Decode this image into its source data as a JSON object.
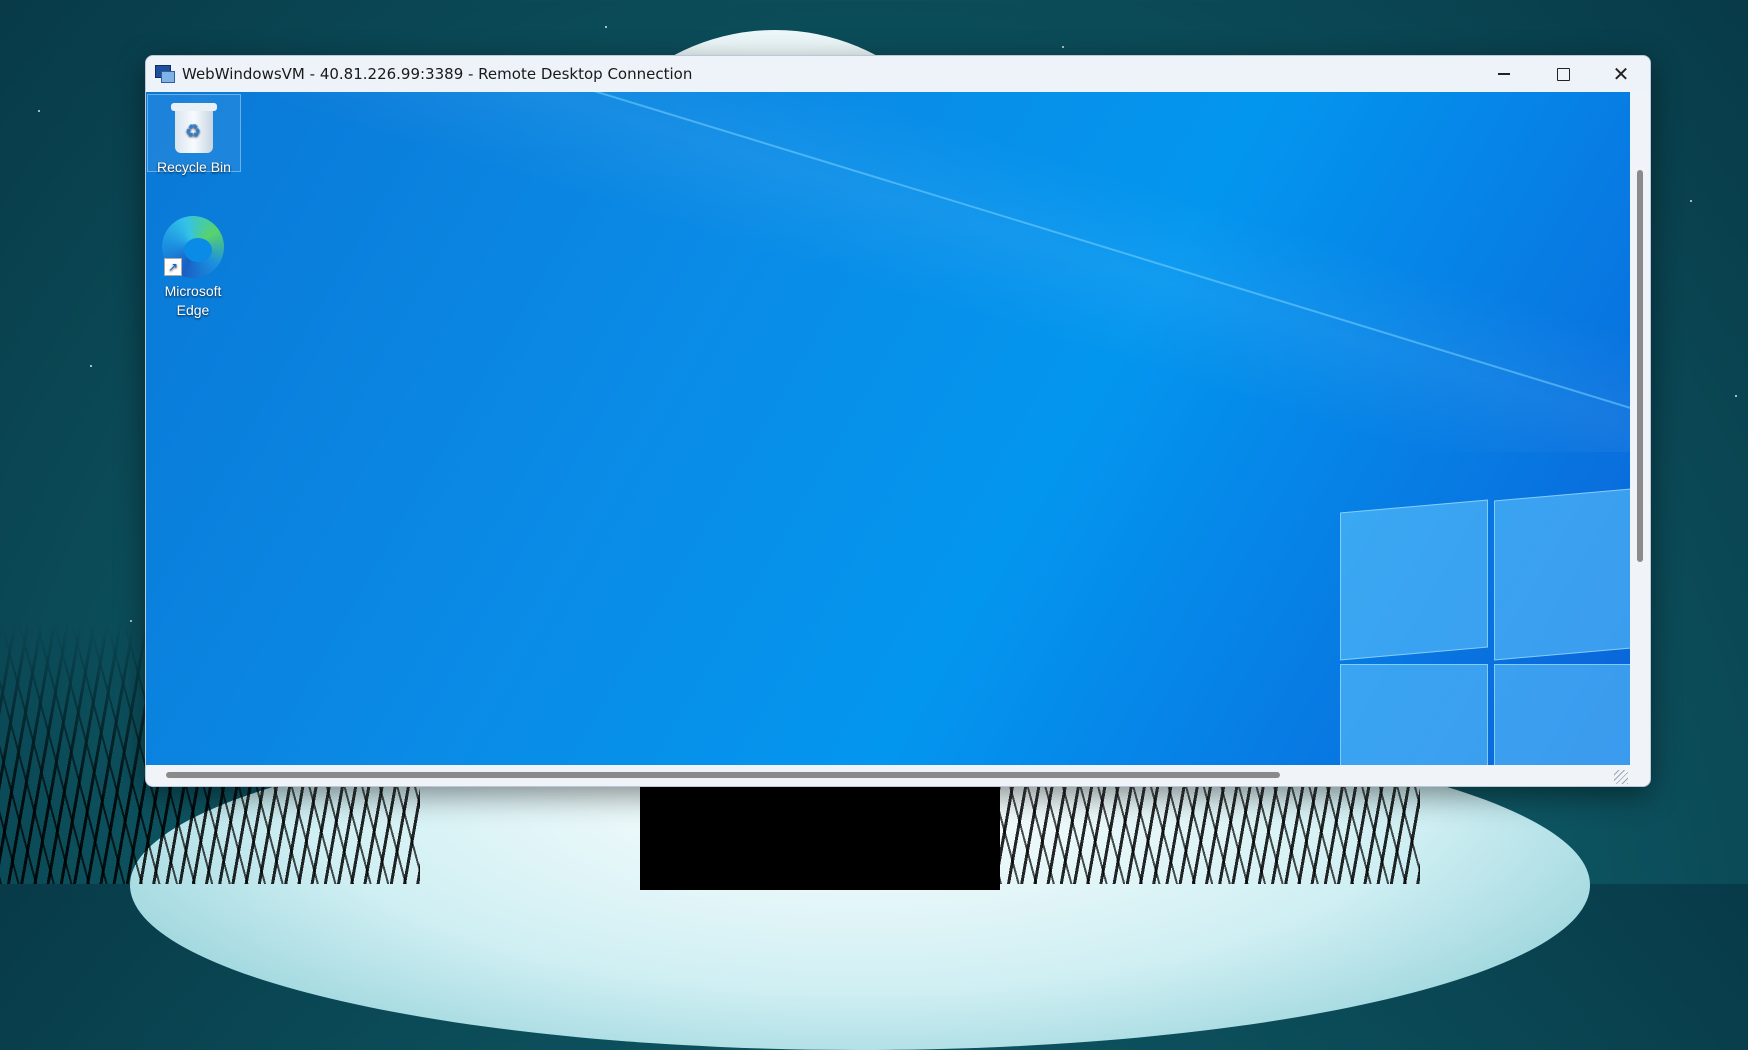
{
  "window": {
    "title": "WebWindowsVM - 40.81.226.99:3389 - Remote Desktop Connection",
    "controls": {
      "minimize": "—",
      "maximize": "☐",
      "close": "✕"
    }
  },
  "remote_desktop": {
    "icons": [
      {
        "label": "Recycle Bin"
      },
      {
        "label": "Microsoft Edge"
      }
    ]
  },
  "colors": {
    "remote_bg": "#0a8be6",
    "titlebar_bg": "#eef3f9",
    "host_bg": "#0e5a66"
  }
}
